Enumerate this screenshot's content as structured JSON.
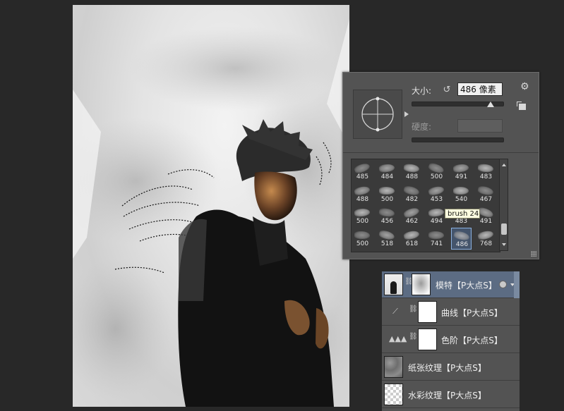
{
  "app": {
    "name": "Photoshop"
  },
  "brush_panel": {
    "size_label": "大小:",
    "size_value": "486 像素",
    "size_slider_level": 0.86,
    "hardness_label": "硬度:",
    "hardness_value": "",
    "tooltip": "brush 24",
    "presets": [
      [
        "485",
        "484",
        "488",
        "500",
        "491",
        "483"
      ],
      [
        "488",
        "500",
        "482",
        "453",
        "540",
        "467"
      ],
      [
        "500",
        "456",
        "462",
        "494",
        "483",
        "491"
      ],
      [
        "500",
        "518",
        "618",
        "741",
        "486",
        "768"
      ]
    ],
    "selected_preset": "486"
  },
  "layers": [
    {
      "name": "模特【P大点S】",
      "active": true,
      "kind": "image-with-mask"
    },
    {
      "name": "曲线【P大点S】",
      "active": false,
      "kind": "curves"
    },
    {
      "name": "色阶【P大点S】",
      "active": false,
      "kind": "levels"
    },
    {
      "name": "纸张纹理【P大点S】",
      "active": false,
      "kind": "paper"
    },
    {
      "name": "水彩纹理【P大点S】",
      "active": false,
      "kind": "watercolor"
    }
  ],
  "colors": {
    "workspace": "#282828",
    "panel": "#535353",
    "selected_layer": "#5c6c83"
  }
}
